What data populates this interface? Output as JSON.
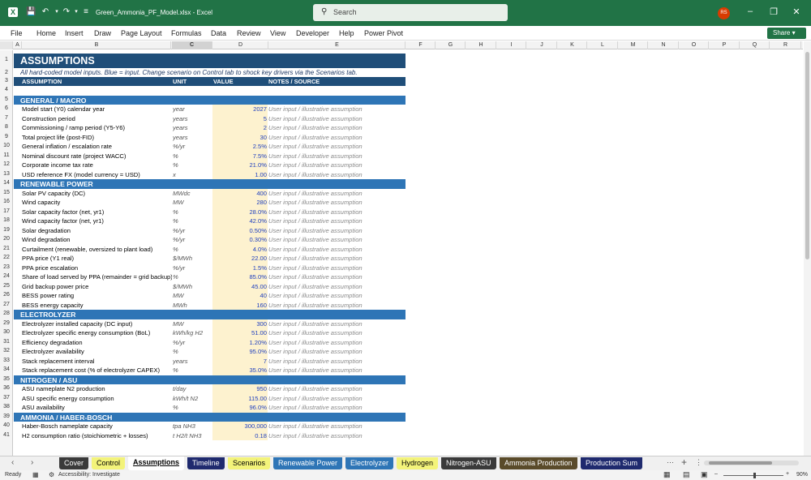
{
  "window": {
    "title": "Green_Ammonia_PF_Model.xlsx  -  Excel",
    "search_placeholder": "Search",
    "avatar_initials": "RS"
  },
  "menu": [
    "File",
    "Home",
    "Insert",
    "Draw",
    "Page Layout",
    "Formulas",
    "Data",
    "Review",
    "View",
    "Developer",
    "Help",
    "Power Pivot"
  ],
  "share_label": "Share",
  "columns": [
    "A",
    "B",
    "C",
    "D",
    "E",
    "F",
    "G",
    "H",
    "I",
    "J",
    "K",
    "L",
    "M",
    "N",
    "O",
    "P",
    "Q",
    "R"
  ],
  "selected_column": "C",
  "sheet": {
    "title": "ASSUMPTIONS",
    "note": "All hard-coded model inputs. Blue = input. Change scenario on Control tab to shock key drivers via the Scenarios tab.",
    "headers": {
      "assumption": "ASSUMPTION",
      "unit": "UNIT",
      "value": "VALUE",
      "notes": "NOTES / SOURCE"
    },
    "rows": [
      {
        "n": "5",
        "type": "section",
        "label": "GENERAL / MACRO"
      },
      {
        "n": "6",
        "label": "Model start (Y0) calendar year",
        "unit": "year",
        "value": "2027",
        "note": "User input / illustrative assumption"
      },
      {
        "n": "7",
        "label": "Construction period",
        "unit": "years",
        "value": "5",
        "note": "User input / illustrative assumption"
      },
      {
        "n": "8",
        "label": "Commissioning / ramp period (Y5-Y6)",
        "unit": "years",
        "value": "2",
        "note": "User input / illustrative assumption"
      },
      {
        "n": "9",
        "label": "Total project life (post-FID)",
        "unit": "years",
        "value": "30",
        "note": "User input / illustrative assumption"
      },
      {
        "n": "10",
        "label": "General inflation / escalation rate",
        "unit": "%/yr",
        "value": "2.5%",
        "note": "User input / illustrative assumption"
      },
      {
        "n": "11",
        "label": "Nominal discount rate (project WACC)",
        "unit": "%",
        "value": "7.5%",
        "note": "User input / illustrative assumption"
      },
      {
        "n": "12",
        "label": "Corporate income tax rate",
        "unit": "%",
        "value": "21.0%",
        "note": "User input / illustrative assumption"
      },
      {
        "n": "13",
        "label": "USD reference FX (model currency = USD)",
        "unit": "x",
        "value": "1.00",
        "note": "User input / illustrative assumption"
      },
      {
        "n": "14",
        "type": "section",
        "label": "RENEWABLE POWER"
      },
      {
        "n": "15",
        "label": "Solar PV capacity (DC)",
        "unit": "MWdc",
        "value": "400",
        "note": "User input / illustrative assumption"
      },
      {
        "n": "16",
        "label": "Wind capacity",
        "unit": "MW",
        "value": "280",
        "note": "User input / illustrative assumption"
      },
      {
        "n": "17",
        "label": "Solar capacity factor (net, yr1)",
        "unit": "%",
        "value": "28.0%",
        "note": "User input / illustrative assumption"
      },
      {
        "n": "18",
        "label": "Wind capacity factor (net, yr1)",
        "unit": "%",
        "value": "42.0%",
        "note": "User input / illustrative assumption"
      },
      {
        "n": "19",
        "label": "Solar degradation",
        "unit": "%/yr",
        "value": "0.50%",
        "note": "User input / illustrative assumption"
      },
      {
        "n": "20",
        "label": "Wind degradation",
        "unit": "%/yr",
        "value": "0.30%",
        "note": "User input / illustrative assumption"
      },
      {
        "n": "21",
        "label": "Curtailment (renewable, oversized to plant load)",
        "unit": "%",
        "value": "4.0%",
        "note": "User input / illustrative assumption"
      },
      {
        "n": "22",
        "label": "PPA price (Y1 real)",
        "unit": "$/MWh",
        "value": "22.00",
        "note": "User input / illustrative assumption"
      },
      {
        "n": "23",
        "label": "PPA price escalation",
        "unit": "%/yr",
        "value": "1.5%",
        "note": "User input / illustrative assumption"
      },
      {
        "n": "24",
        "label": "Share of load served by PPA (remainder = grid backup)",
        "unit": "%",
        "value": "85.0%",
        "note": "User input / illustrative assumption"
      },
      {
        "n": "25",
        "label": "Grid backup power price",
        "unit": "$/MWh",
        "value": "45.00",
        "note": "User input / illustrative assumption"
      },
      {
        "n": "26",
        "label": "BESS power rating",
        "unit": "MW",
        "value": "40",
        "note": "User input / illustrative assumption"
      },
      {
        "n": "27",
        "label": "BESS energy capacity",
        "unit": "MWh",
        "value": "160",
        "note": "User input / illustrative assumption"
      },
      {
        "n": "28",
        "type": "section",
        "label": "ELECTROLYZER"
      },
      {
        "n": "29",
        "label": "Electrolyzer installed capacity (DC input)",
        "unit": "MW",
        "value": "300",
        "note": "User input / illustrative assumption"
      },
      {
        "n": "30",
        "label": "Electrolyzer specific energy consumption (BoL)",
        "unit": "kWh/kg H2",
        "value": "51.00",
        "note": "User input / illustrative assumption"
      },
      {
        "n": "31",
        "label": "Efficiency degradation",
        "unit": "%/yr",
        "value": "1.20%",
        "note": "User input / illustrative assumption"
      },
      {
        "n": "32",
        "label": "Electrolyzer availability",
        "unit": "%",
        "value": "95.0%",
        "note": "User input / illustrative assumption"
      },
      {
        "n": "33",
        "label": "Stack replacement interval",
        "unit": "years",
        "value": "7",
        "note": "User input / illustrative assumption"
      },
      {
        "n": "34",
        "label": "Stack replacement cost (% of electrolyzer CAPEX)",
        "unit": "%",
        "value": "35.0%",
        "note": "User input / illustrative assumption"
      },
      {
        "n": "35",
        "type": "section",
        "label": "NITROGEN / ASU"
      },
      {
        "n": "36",
        "label": "ASU nameplate N2 production",
        "unit": "t/day",
        "value": "950",
        "note": "User input / illustrative assumption"
      },
      {
        "n": "37",
        "label": "ASU specific energy consumption",
        "unit": "kWh/t N2",
        "value": "115.00",
        "note": "User input / illustrative assumption"
      },
      {
        "n": "38",
        "label": "ASU availability",
        "unit": "%",
        "value": "96.0%",
        "note": "User input / illustrative assumption"
      },
      {
        "n": "39",
        "type": "section",
        "label": "AMMONIA / HABER-BOSCH"
      },
      {
        "n": "40",
        "label": "Haber-Bosch nameplate capacity",
        "unit": "tpa NH3",
        "value": "300,000",
        "note": "User input / illustrative assumption"
      },
      {
        "n": "41",
        "label": "H2 consumption ratio (stoichiometric + losses)",
        "unit": "t H2/t NH3",
        "value": "0.18",
        "note": "User input / illustrative assumption"
      }
    ]
  },
  "tabs": [
    {
      "label": "Cover",
      "bg": "#3a3a3a",
      "fg": "#ffffff"
    },
    {
      "label": "Control",
      "bg": "#f3f37a",
      "fg": "#000000"
    },
    {
      "label": "Assumptions",
      "bg": "#ffffff",
      "fg": "#000000",
      "active": true
    },
    {
      "label": "Timeline",
      "bg": "#1f2a6e",
      "fg": "#ffffff"
    },
    {
      "label": "Scenarios",
      "bg": "#f3f37a",
      "fg": "#000000"
    },
    {
      "label": "Renewable Power",
      "bg": "#2e75b6",
      "fg": "#ffffff"
    },
    {
      "label": "Electrolyzer",
      "bg": "#2e75b6",
      "fg": "#ffffff"
    },
    {
      "label": "Hydrogen",
      "bg": "#f3f37a",
      "fg": "#000000"
    },
    {
      "label": "Nitrogen-ASU",
      "bg": "#3a3a3a",
      "fg": "#ffffff"
    },
    {
      "label": "Ammonia Production",
      "bg": "#5a4b2a",
      "fg": "#ffffff"
    },
    {
      "label": "Production Sum",
      "bg": "#1f2a6e",
      "fg": "#ffffff"
    }
  ],
  "status": {
    "ready": "Ready",
    "accessibility": "Accessibility: Investigate",
    "zoom": "90%"
  },
  "colors": {
    "excel_green": "#217346",
    "section_blue": "#2e75b6",
    "header_navy": "#1f4e79",
    "input_fill": "#fdf2cf",
    "input_text": "#1f3fbf"
  }
}
